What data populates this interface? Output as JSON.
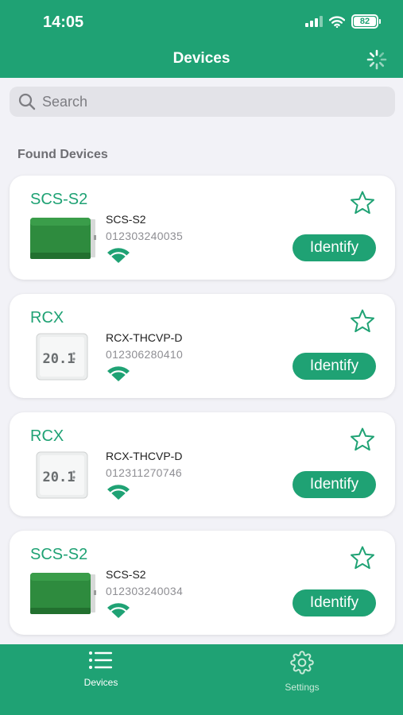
{
  "status": {
    "time": "14:05",
    "battery": "82"
  },
  "nav": {
    "title": "Devices"
  },
  "search": {
    "placeholder": "Search"
  },
  "section": {
    "header": "Found Devices"
  },
  "colors": {
    "accent": "#1fa274",
    "background": "#f2f2f7"
  },
  "devices": [
    {
      "name": "SCS-S2",
      "model": "SCS-S2",
      "serial": "012303240035",
      "button": "Identify",
      "image": "scs-s2-unit"
    },
    {
      "name": "RCX",
      "model": "RCX-THCVP-D",
      "serial": "012306280410",
      "button": "Identify",
      "image": "thermostat-display",
      "display": "20.1"
    },
    {
      "name": "RCX",
      "model": "RCX-THCVP-D",
      "serial": "012311270746",
      "button": "Identify",
      "image": "thermostat-display",
      "display": "20.1"
    },
    {
      "name": "SCS-S2",
      "model": "SCS-S2",
      "serial": "012303240034",
      "button": "Identify",
      "image": "scs-s2-unit"
    }
  ],
  "tabs": [
    {
      "label": "Devices",
      "icon": "list-icon",
      "active": true
    },
    {
      "label": "Settings",
      "icon": "gear-icon",
      "active": false
    }
  ]
}
